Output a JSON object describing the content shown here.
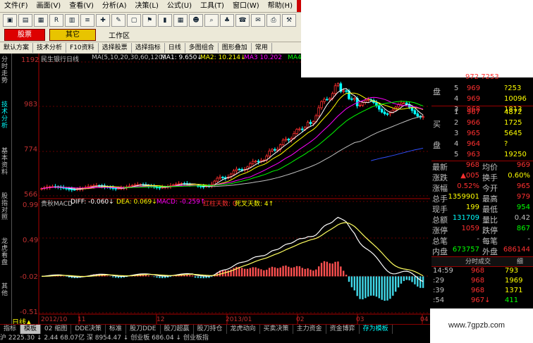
{
  "menu": [
    "文件(F)",
    "画面(V)",
    "查看(V)",
    "分析(A)",
    "决策(L)",
    "公式(U)",
    "工具(T)",
    "窗口(W)",
    "帮助(H)",
    "委托"
  ],
  "tabs": {
    "stock": "股票",
    "other": "其它",
    "workarea": "工作区"
  },
  "funcs": [
    "默认方案",
    "技术分析",
    "F10资料",
    "选择股票",
    "选择指标",
    "日线",
    "多图组合",
    "图形叠加",
    "常用"
  ],
  "side": [
    "分时走势",
    "技术分析",
    "基本资料",
    "股指对照",
    "龙虎看盘",
    "其他"
  ],
  "header": {
    "name": "民生银行日线",
    "ma": "MA(5,10,20,30,60,120)",
    "ma1": "MA1: 9.650↓",
    "ma2": "MA2: 10.214↓",
    "ma3": "MA3  10.202",
    "ma4": "MA4:"
  },
  "price_axis": {
    "p1": "1192",
    "p2": "983",
    "p3": "774",
    "p4": "566"
  },
  "macd_header": {
    "title": "贵秋MACD",
    "diff": "DIFF: -0.060↓",
    "dea": "DEA: 0.069↓",
    "macd": "MACD: -0.259↑",
    "red": "红柱天数: 0",
    "dead": "死叉天数: 4↑"
  },
  "macd_axis": {
    "a1": "0.99",
    "a2": "0.49",
    "a3": "-0.02",
    "a4": "-0.51"
  },
  "dates": {
    "d1": "2012/10",
    "d2": "11",
    "d3": "12",
    "d4": "2013/01",
    "d5": "02",
    "d6": "03",
    "d7": "04"
  },
  "period": "日线▲",
  "bottom_tabs": [
    "指标",
    "模板",
    "02 缩图",
    "DDE决策",
    "标准",
    "股刀DDE",
    "股刀超赢",
    "股刀持仓",
    "龙虎动向",
    "买卖决策",
    "主力资金",
    "资金博弈",
    "存为模板"
  ],
  "status": "沪 2225.30 ↓ 2.44  68.07亿  深 8954.47 ↓  创业板  686.04 ↓  创业板指",
  "orderbook": {
    "sell": [
      [
        "5",
        "969",
        "?253"
      ],
      [
        "4",
        "969",
        "10096"
      ],
      [
        "3",
        "968",
        "1813"
      ]
    ],
    "sell_top": "972 7253",
    "buy": [
      [
        "1",
        "967",
        "4872"
      ],
      [
        "2",
        "966",
        "1725"
      ],
      [
        "3",
        "965",
        "5645"
      ],
      [
        "4",
        "964",
        "?"
      ],
      [
        "5",
        "963",
        "19250"
      ]
    ],
    "side_sell": "卖",
    "side_buy": "买",
    "pan": "盘"
  },
  "stats": [
    [
      "最新",
      "968",
      "均价",
      "969"
    ],
    [
      "涨跌",
      "▲005",
      "换手",
      "0.60%"
    ],
    [
      "涨幅",
      "0.52%",
      "今开",
      "965"
    ],
    [
      "总手",
      "1359901",
      "最高",
      "979"
    ],
    [
      "现手",
      "199",
      "最低",
      "954"
    ],
    [
      "总额",
      "131709",
      "量比",
      "0.42"
    ],
    [
      "涨停",
      "1059",
      "跌停",
      "867"
    ],
    [
      "总笔",
      "-",
      "每笔",
      "-"
    ],
    [
      "内盘",
      "673757",
      "外盘",
      "686144"
    ]
  ],
  "ticks_title": "分时成交",
  "ticks_btn": "细",
  "ticks": [
    [
      "14:59",
      "968",
      "793"
    ],
    [
      ":29",
      "968",
      "1969"
    ],
    [
      ":39",
      "968",
      "1371"
    ],
    [
      ":54",
      "967↓",
      "411"
    ]
  ],
  "watermark": "www.7gpzb.com"
}
